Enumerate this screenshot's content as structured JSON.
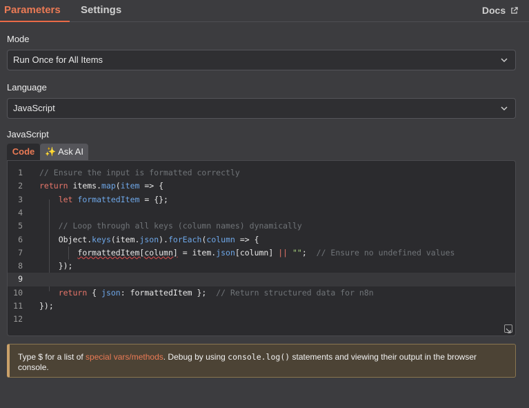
{
  "tabs": {
    "parameters": "Parameters",
    "settings": "Settings",
    "docs": "Docs"
  },
  "mode": {
    "label": "Mode",
    "value": "Run Once for All Items"
  },
  "language": {
    "label": "Language",
    "value": "JavaScript"
  },
  "editor": {
    "label": "JavaScript",
    "code_tab": "Code",
    "ask_ai_tab": "✨ Ask AI",
    "line_numbers": [
      "1",
      "2",
      "3",
      "4",
      "5",
      "6",
      "7",
      "8",
      "9",
      "10",
      "11",
      "12"
    ],
    "active_line": 9
  },
  "notice": {
    "pre": "Type $ for a list of ",
    "link": "special vars/methods",
    "mid": ". Debug by using ",
    "code": "console.log()",
    "post": " statements and viewing their output in the browser console."
  },
  "colors": {
    "accent": "#ea6a47",
    "background": "#3c3c3f",
    "editor_bg": "#2b2b2e",
    "notice_bg": "#4c4335"
  }
}
